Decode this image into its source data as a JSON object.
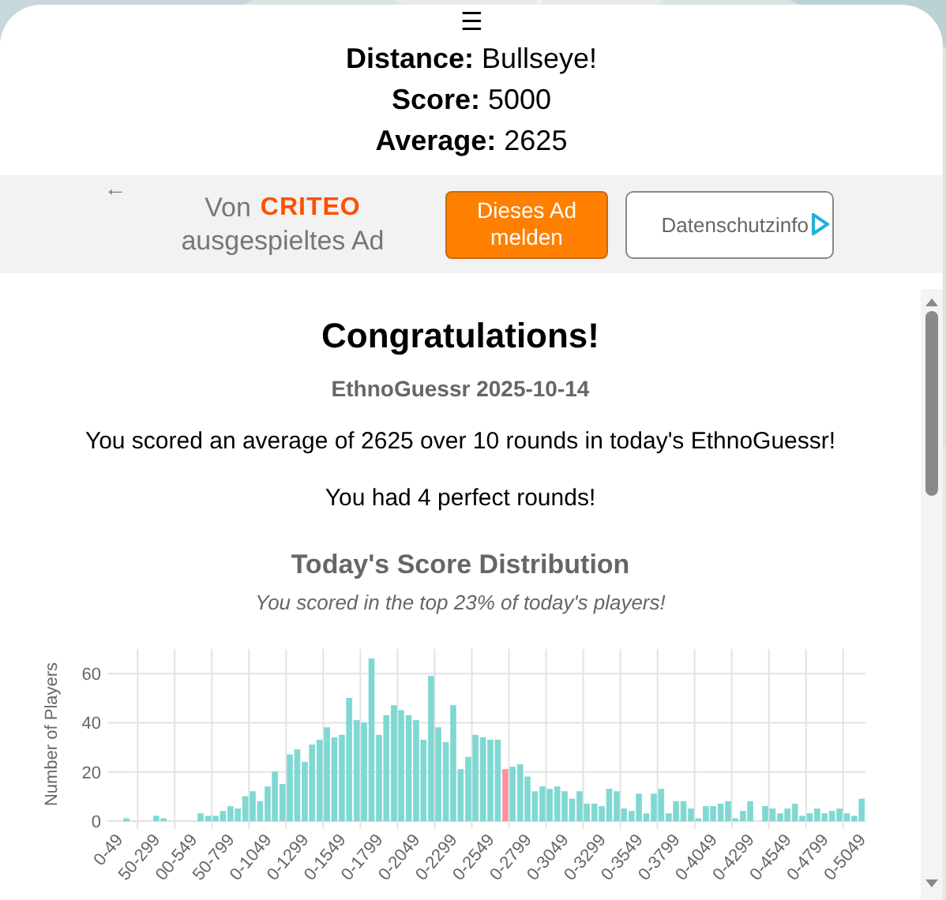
{
  "menu_icon": "☰",
  "result": [
    {
      "label": "Distance:",
      "value": "Bullseye!"
    },
    {
      "label": "Score:",
      "value": "5000"
    },
    {
      "label": "Average:",
      "value": "2625"
    }
  ],
  "ad": {
    "back": "←",
    "prefix": "Von",
    "brand": "CRITEO",
    "suffix": "ausgespieltes Ad",
    "report_button": "Dieses Ad melden",
    "privacy_button": "Datenschutzinfo"
  },
  "summary": {
    "title": "Congratulations!",
    "subtitle": "EthnoGuessr 2025-10-14",
    "lines": [
      "You scored an average of 2625 over 10 rounds in today's EthnoGuessr!",
      "You had 4 perfect rounds!"
    ]
  },
  "distribution": {
    "title": "Today's Score Distribution",
    "subtitle": "You scored in the top 23% of today's players!",
    "chart_data": {
      "type": "bar",
      "ylabel": "Number of Players",
      "ylim": [
        0,
        70
      ],
      "yticks": [
        0,
        20,
        40,
        60
      ],
      "grid": true,
      "stacked": true,
      "categories": [
        "0-49",
        null,
        null,
        null,
        null,
        "50-299",
        null,
        null,
        null,
        null,
        "00-549",
        null,
        null,
        null,
        null,
        "50-799",
        null,
        null,
        null,
        null,
        "0-1049",
        null,
        null,
        null,
        null,
        "0-1299",
        null,
        null,
        null,
        null,
        "0-1549",
        null,
        null,
        null,
        null,
        "0-1799",
        null,
        null,
        null,
        null,
        "0-2049",
        null,
        null,
        null,
        null,
        "0-2299",
        null,
        null,
        null,
        null,
        "0-2549",
        null,
        null,
        null,
        null,
        "0-2799",
        null,
        null,
        null,
        null,
        "0-3049",
        null,
        null,
        null,
        null,
        "0-3299",
        null,
        null,
        null,
        null,
        "0-3549",
        null,
        null,
        null,
        null,
        "0-3799",
        null,
        null,
        null,
        null,
        "0-4049",
        null,
        null,
        null,
        null,
        "0-4299",
        null,
        null,
        null,
        null,
        "0-4549",
        null,
        null,
        null,
        null,
        "0-4799",
        null,
        null,
        null,
        null,
        "0-5049"
      ],
      "series": [
        {
          "color": "#7fd8d2",
          "values": [
            0,
            1,
            0,
            0,
            0,
            2,
            1,
            0,
            0,
            0,
            0,
            3,
            2,
            2,
            4,
            6,
            5,
            10,
            12,
            8,
            14,
            20,
            15,
            27,
            29,
            24,
            31,
            33,
            38,
            34,
            35,
            50,
            41,
            40,
            66,
            35,
            43,
            47,
            45,
            43,
            41,
            33,
            59,
            38,
            32,
            47,
            21,
            26,
            35,
            34,
            33,
            33,
            null,
            22,
            23,
            18,
            12,
            14,
            13,
            14,
            12,
            9,
            12,
            7,
            7,
            6,
            13,
            12,
            5,
            4,
            11,
            3,
            11,
            13,
            3,
            8,
            8,
            5,
            1,
            6,
            6,
            7,
            8,
            1,
            4,
            8,
            0,
            6,
            5,
            3,
            5,
            7,
            2,
            3,
            5,
            3,
            4,
            5,
            3,
            2,
            9
          ]
        },
        {
          "color": "#ff8fa3",
          "values": [
            null,
            null,
            null,
            null,
            null,
            null,
            null,
            null,
            null,
            null,
            null,
            null,
            null,
            null,
            null,
            null,
            null,
            null,
            null,
            null,
            null,
            null,
            null,
            null,
            null,
            null,
            null,
            null,
            null,
            null,
            null,
            null,
            null,
            null,
            null,
            null,
            null,
            null,
            null,
            null,
            null,
            null,
            null,
            null,
            null,
            null,
            null,
            null,
            null,
            null,
            null,
            null,
            21,
            null,
            null,
            null,
            null,
            null,
            null,
            null,
            null,
            null,
            null,
            null,
            null,
            null,
            null,
            null,
            null,
            null,
            null,
            null,
            null,
            null,
            null,
            null,
            null,
            null,
            null,
            null,
            null,
            null,
            null,
            null,
            null,
            null,
            null,
            null,
            null,
            null,
            null,
            null,
            null,
            null,
            null,
            null,
            null,
            null,
            null,
            null,
            null
          ]
        }
      ]
    }
  }
}
